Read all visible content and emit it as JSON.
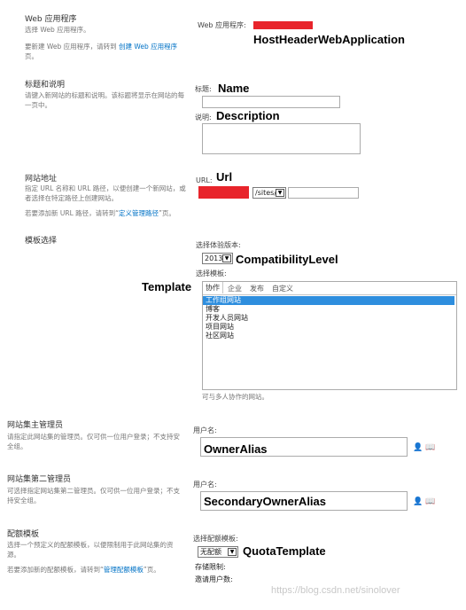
{
  "sections": {
    "webapp": {
      "title": "Web 应用程序",
      "desc": "选择 Web 应用程序。",
      "desc2_prefix": "要新建 Web 应用程序，请转到",
      "desc2_link": "创建 Web 应用程序",
      "desc2_suffix": "页。",
      "field_label": "Web 应用程序:",
      "annotation": "HostHeaderWebApplication"
    },
    "title_desc": {
      "title": "标题和说明",
      "desc": "请键入新网站的标题和说明。该标题将显示在网站的每一页中。",
      "title_label": "标题:",
      "title_annotation": "Name",
      "desc_label": "说明:",
      "desc_annotation": "Description"
    },
    "address": {
      "title": "网站地址",
      "desc": "指定 URL 名称和 URL 路径，以便创建一个新网站，或者选择在特定路径上创建网站。",
      "desc2_prefix": "若要添加新 URL 路径，请转到“",
      "desc2_link": "定义管理路径",
      "desc2_suffix": "”页。",
      "url_label": "URL:",
      "url_annotation": "Url",
      "path_value": "/sites/"
    },
    "template": {
      "title": "模板选择",
      "version_label": "选择体验版本:",
      "version_value": "2013",
      "version_annotation": "CompatibilityLevel",
      "template_label": "选择模板:",
      "template_annotation": "Template",
      "tabs": [
        "协作",
        "企业",
        "发布",
        "自定义"
      ],
      "items": [
        "工作组网站",
        "博客",
        "开发人员网站",
        "项目网站",
        "社区网站"
      ],
      "selected_index": 0,
      "note": "可与多人协作的网站。"
    },
    "primary_admin": {
      "title": "网站集主管理员",
      "desc": "请指定此网站集的管理员。仅可供一位用户登录；不支持安全组。",
      "user_label": "用户名:",
      "annotation": "OwnerAlias"
    },
    "secondary_admin": {
      "title": "网站集第二管理员",
      "desc": "可选择指定网站集第二管理员。仅可供一位用户登录；不支持安全组。",
      "user_label": "用户名:",
      "annotation": "SecondaryOwnerAlias"
    },
    "quota": {
      "title": "配额模板",
      "desc": "选择一个预定义的配额模板，以便限制用于此网站集的资源。",
      "desc2_prefix": "若要添加新的配额模板，请转到“",
      "desc2_link": "管理配额模板",
      "desc2_suffix": "”页。",
      "select_label": "选择配额模板:",
      "select_value": "无配额",
      "annotation": "QuotaTemplate",
      "storage_label": "存储限制:",
      "invite_label": "邀请用户数:"
    }
  },
  "watermark": "https://blog.csdn.net/sinolover",
  "icons": {
    "person": "person-check-icon",
    "book": "address-book-icon"
  }
}
